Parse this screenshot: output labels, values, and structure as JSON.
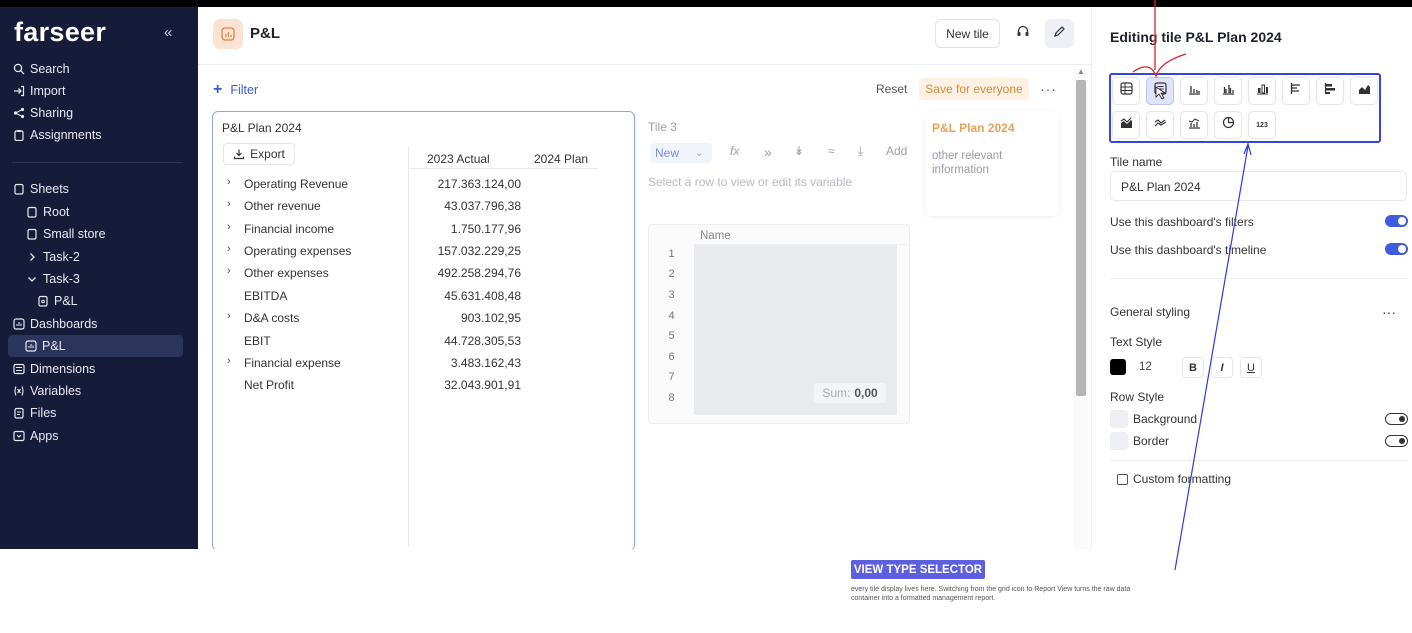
{
  "sidebar": {
    "logo": "farseer",
    "collapse_glyph": "«",
    "top_items": [
      {
        "label": "Search",
        "icon": "search-icon"
      },
      {
        "label": "Import",
        "icon": "import-icon"
      },
      {
        "label": "Sharing",
        "icon": "share-icon"
      },
      {
        "label": "Assignments",
        "icon": "clipboard-icon"
      }
    ],
    "tree": [
      {
        "label": "Sheets",
        "icon": "sheets-icon"
      },
      {
        "label": "Root",
        "icon": "sheet-icon"
      },
      {
        "label": "Small store",
        "icon": "sheet-icon"
      },
      {
        "label": "Task-2",
        "icon": "chevron-right-icon"
      },
      {
        "label": "Task-3",
        "icon": "chevron-down-icon"
      },
      {
        "label": "P&L",
        "icon": "document-icon"
      },
      {
        "label": "Dashboards",
        "icon": "dashboard-icon"
      },
      {
        "label": "P&L",
        "icon": "chart-tile-icon"
      },
      {
        "label": "Dimensions",
        "icon": "dimensions-icon"
      },
      {
        "label": "Variables",
        "icon": "variables-icon"
      },
      {
        "label": "Files",
        "icon": "files-icon"
      },
      {
        "label": "Apps",
        "icon": "apps-icon"
      }
    ]
  },
  "header": {
    "title": "P&L",
    "new_tile": "New tile"
  },
  "toolbar": {
    "filter": "Filter",
    "reset": "Reset",
    "save_for_everyone": "Save for everyone",
    "more": "···"
  },
  "main_tile": {
    "title": "P&L Plan 2024",
    "export": "Export",
    "columns": [
      "2023 Actual",
      "2024 Plan"
    ],
    "rows": [
      {
        "label": "Operating Revenue",
        "value": "217.363.124,00",
        "expandable": true
      },
      {
        "label": "Other revenue",
        "value": "43.037.796,38",
        "expandable": true
      },
      {
        "label": "Financial income",
        "value": "1.750.177,96",
        "expandable": true
      },
      {
        "label": "Operating expenses",
        "value": "157.032.229,25",
        "expandable": true
      },
      {
        "label": "Other expenses",
        "value": "492.258.294,76",
        "expandable": true
      },
      {
        "label": "EBITDA",
        "value": "45.631.408,48",
        "expandable": false
      },
      {
        "label": "D&A costs",
        "value": "903.102,95",
        "expandable": true
      },
      {
        "label": "EBIT",
        "value": "44.728.305,53",
        "expandable": false
      },
      {
        "label": "Financial expense",
        "value": "3.483.162,43",
        "expandable": true
      },
      {
        "label": "Net Profit",
        "value": "32.043.901,91",
        "expandable": false
      }
    ]
  },
  "tile3": {
    "title": "Tile 3",
    "new_label": "New",
    "add_label": "Add",
    "hint": "Select a row to view or edit its variable",
    "grid_header": "Name",
    "row_numbers": [
      "1",
      "2",
      "3",
      "4",
      "5",
      "6",
      "7",
      "8"
    ],
    "sum_label": "Sum:",
    "sum_value": "0,00"
  },
  "side_tile": {
    "title": "P&L Plan 2024",
    "description": "other relevant information"
  },
  "panel": {
    "title": "Editing tile P&L Plan 2024",
    "tile_name_label": "Tile name",
    "tile_name_value": "P&L Plan 2024",
    "use_filters": "Use this dashboard's filters",
    "use_timeline": "Use this dashboard's timeline",
    "general_styling": "General styling",
    "general_more": "···",
    "text_style": "Text Style",
    "font_size": "12",
    "bold": "B",
    "italic": "I",
    "underline": "U",
    "row_style": "Row Style",
    "background": "Background",
    "border": "Border",
    "custom_formatting": "Custom formatting",
    "text_color": "#000000",
    "number_button": "123",
    "view_types": [
      "grid-view-icon",
      "report-view-icon",
      "bar-chart-icon",
      "grouped-bar-icon",
      "stacked-bar-icon",
      "horizontal-bar-icon",
      "horizontal-stacked-icon",
      "area-chart-icon",
      "stacked-area-icon",
      "line-chart-icon",
      "combo-chart-icon",
      "pie-chart-icon",
      "number-kpi-icon"
    ]
  },
  "annotation": {
    "badge": "VIEW TYPE SELECTOR",
    "text": "every tile display lives here. Switching from the grid icon to Report View turns the raw data container into a formatted management report.",
    "badge_color": "#5b5fe0",
    "arrow_color": "#2e3cd6",
    "pointer_color": "#d6252b"
  }
}
